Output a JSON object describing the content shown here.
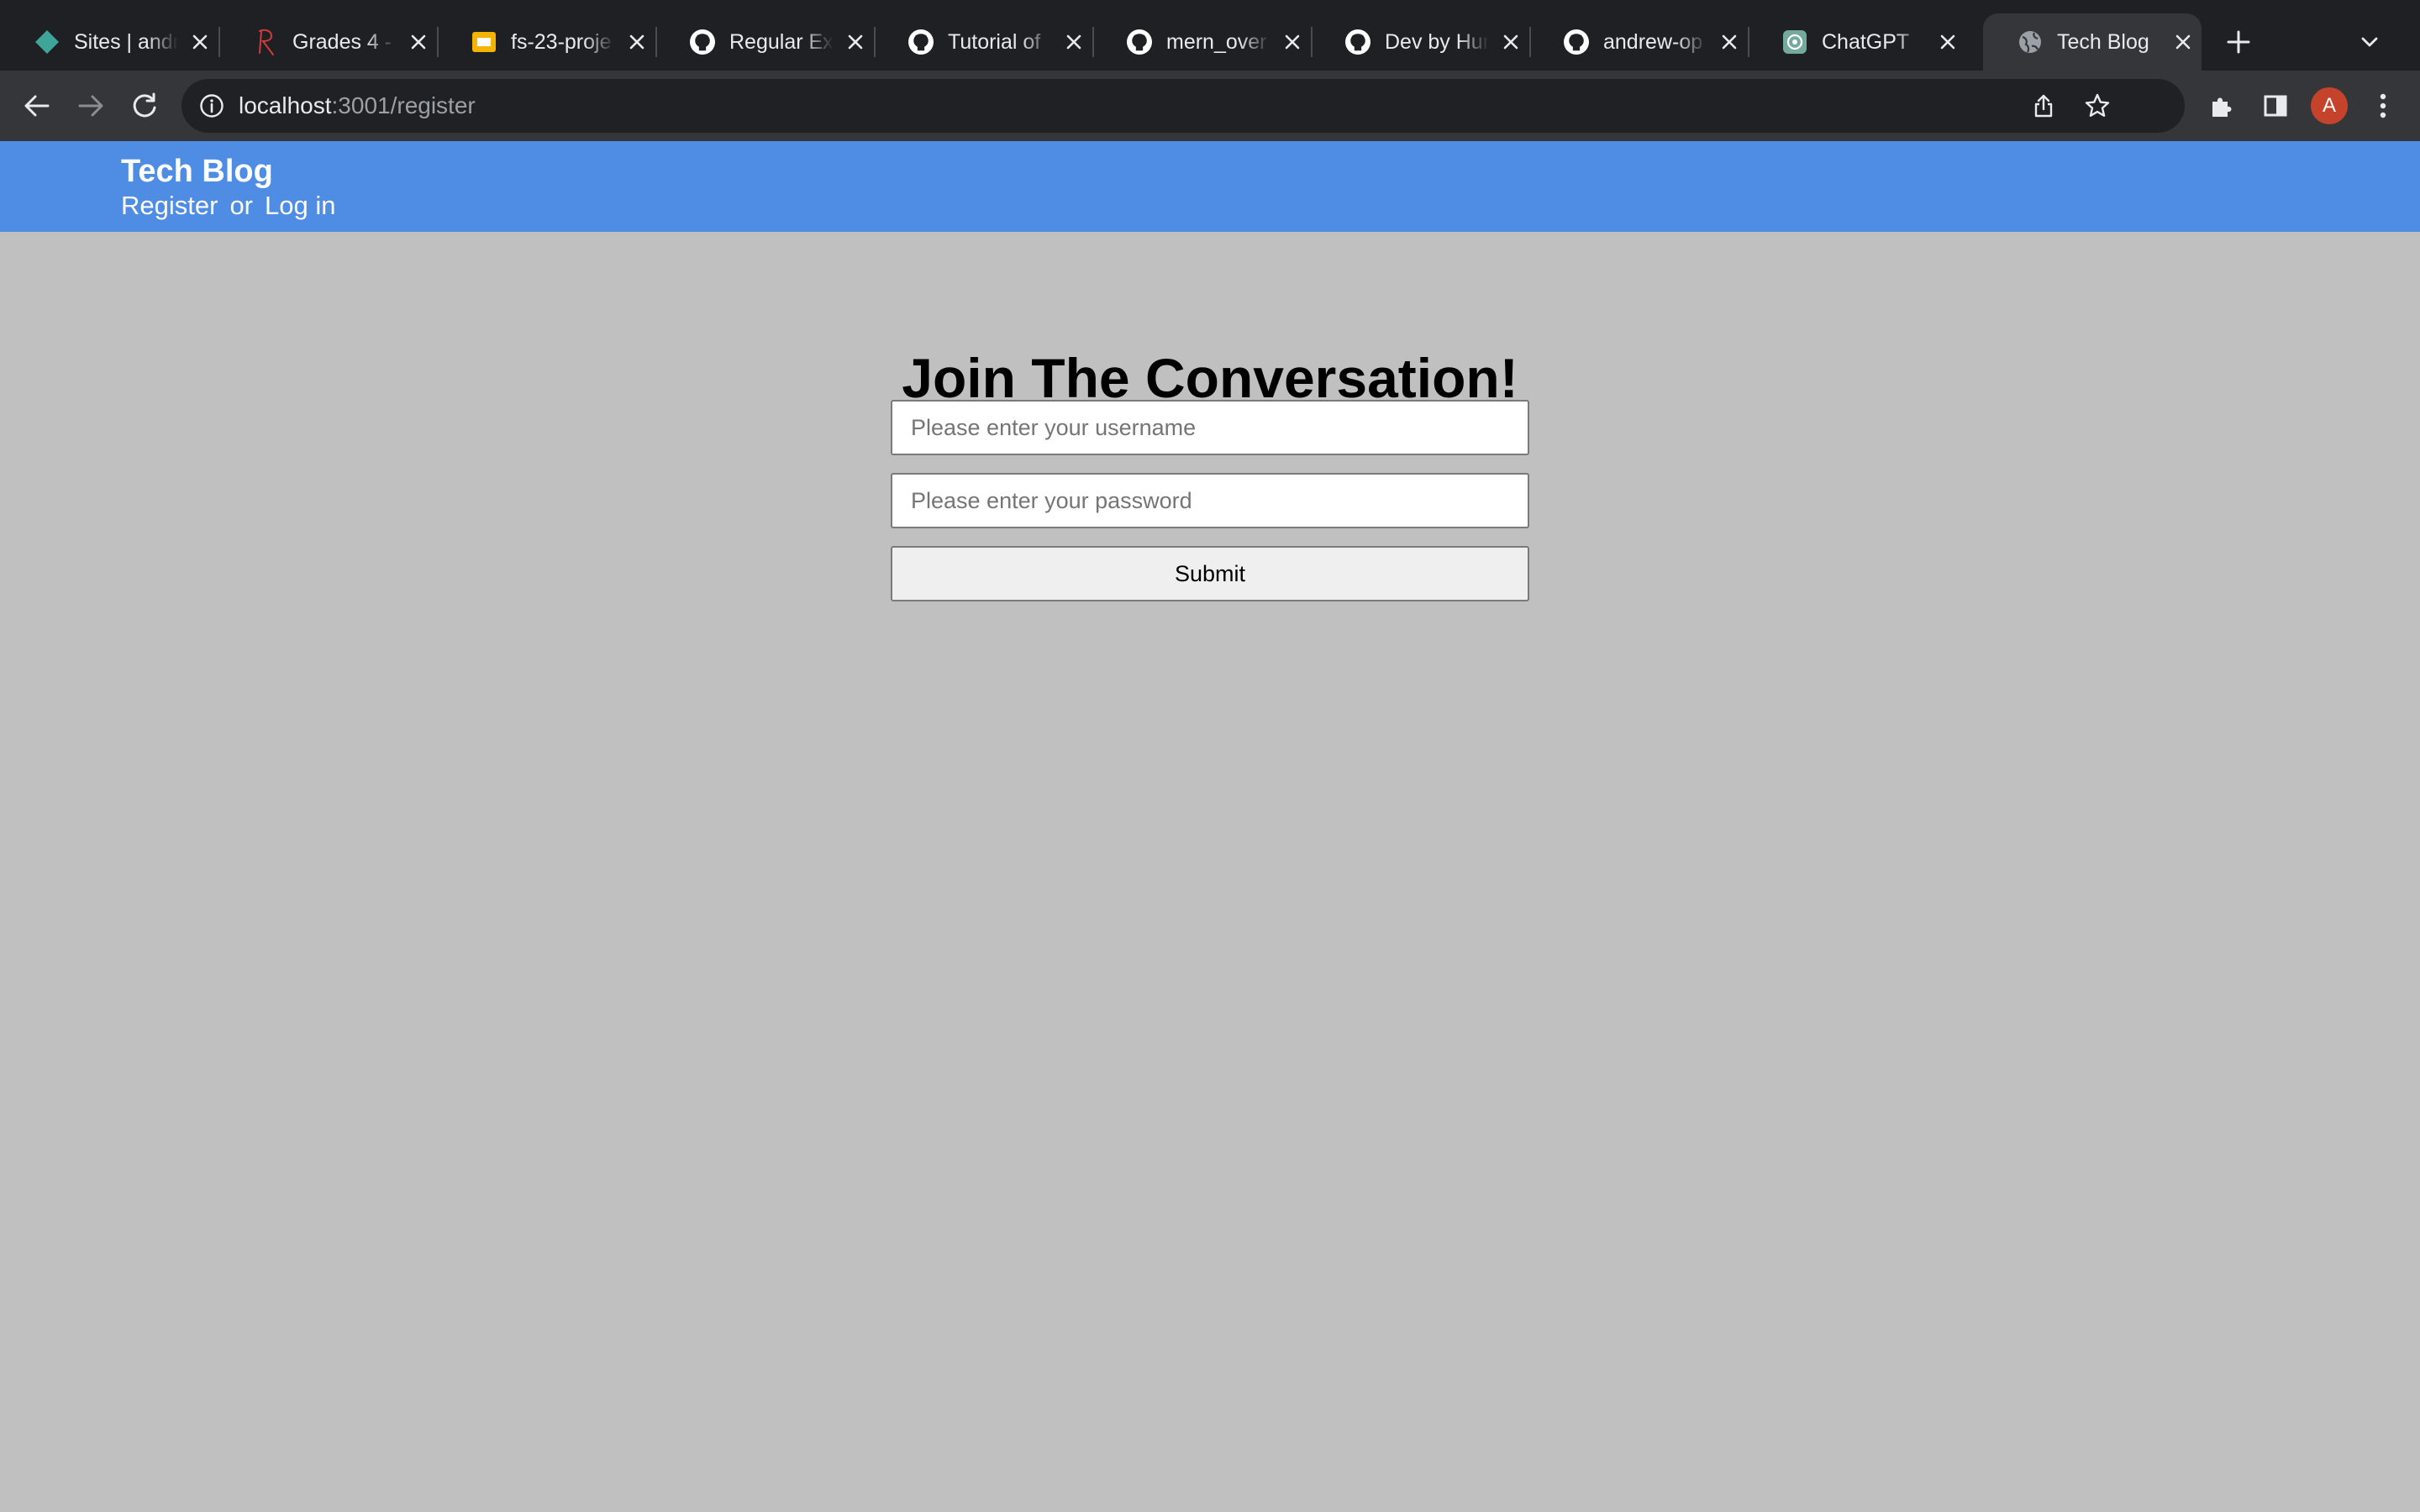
{
  "browser": {
    "tabs": [
      {
        "title": "Sites | andr",
        "icon": "diamond-icon"
      },
      {
        "title": "Grades 4 -",
        "icon": "r-logo-icon"
      },
      {
        "title": "fs-23-proje",
        "icon": "slides-icon"
      },
      {
        "title": "Regular Exp",
        "icon": "github-icon"
      },
      {
        "title": "Tutorial of",
        "icon": "github-icon"
      },
      {
        "title": "mern_over",
        "icon": "github-icon"
      },
      {
        "title": "Dev by Hur",
        "icon": "github-icon"
      },
      {
        "title": "andrew-op",
        "icon": "github-icon"
      },
      {
        "title": "ChatGPT",
        "icon": "chatgpt-icon"
      },
      {
        "title": "Tech Blog",
        "icon": "globe-icon"
      }
    ],
    "active_tab": 9,
    "url_host": "localhost",
    "url_rest": ":3001/register",
    "profile_initial": "A",
    "colors": {
      "tabstrip": "#1f2023",
      "toolbar": "#35363a",
      "avatar": "#c5432a"
    }
  },
  "site": {
    "title": "Tech Blog",
    "nav": {
      "register": "Register",
      "or": "or",
      "login": "Log in"
    },
    "header_color": "#4f8ce3",
    "background": "#c0c0c0"
  },
  "form": {
    "heading": "Join The Conversation!",
    "username_placeholder": "Please enter your username",
    "password_placeholder": "Please enter your password",
    "submit_label": "Submit"
  }
}
